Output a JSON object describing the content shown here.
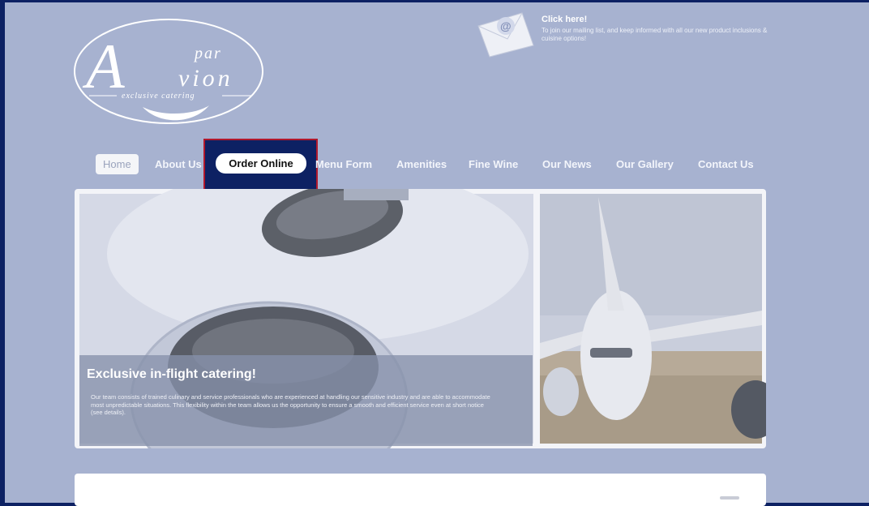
{
  "logo": {
    "script_letter": "A",
    "line1": "par",
    "line2": "vion",
    "tagline": "exclusive catering"
  },
  "mailing": {
    "icon": "envelope-at-icon",
    "title": "Click here!",
    "text": "To join our mailing list, and keep informed with all our new product inclusions & cuisine options!"
  },
  "nav": {
    "items": [
      {
        "label": "Home"
      },
      {
        "label": "About Us"
      },
      {
        "label": "Order Online"
      },
      {
        "label": "Menu Form"
      },
      {
        "label": "Amenities"
      },
      {
        "label": "Fine Wine"
      },
      {
        "label": "Our News"
      },
      {
        "label": "Our Gallery"
      },
      {
        "label": "Contact Us"
      }
    ]
  },
  "hero": {
    "caption_title": "Exclusive in-flight catering!",
    "caption_text": "Our team consists of trained culinary and service professionals who are experienced at handling our sensitive industry and are able to accommodate most unpredictable situations. This flexibility within the team allows us the opportunity to ensure a smooth and efficient service even at short notice (see details)."
  },
  "colors": {
    "frame": "#0d2163",
    "page_bg": "#a7b2d0",
    "highlight_border": "#b0182c"
  }
}
